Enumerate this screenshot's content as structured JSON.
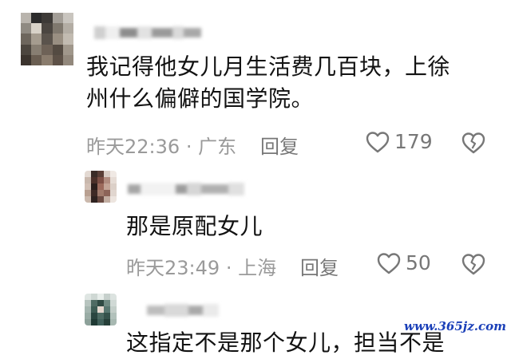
{
  "comments": [
    {
      "text_line1": "我记得他女儿月生活费几百块，上徐",
      "text_line2": "州什么偏僻的国学院。",
      "time": "昨天22:36",
      "location": "广东",
      "reply_label": "回复",
      "likes": "179"
    },
    {
      "text_line1": "那是原配女儿",
      "time": "昨天23:49",
      "location": "上海",
      "reply_label": "回复",
      "likes": "50"
    },
    {
      "text_line1": "这指定不是那个女儿，担当不是"
    }
  ],
  "separator": "·",
  "watermark": "www.365jz.com",
  "icons": {
    "like": "heart-outline-icon",
    "dislike": "broken-heart-icon"
  }
}
